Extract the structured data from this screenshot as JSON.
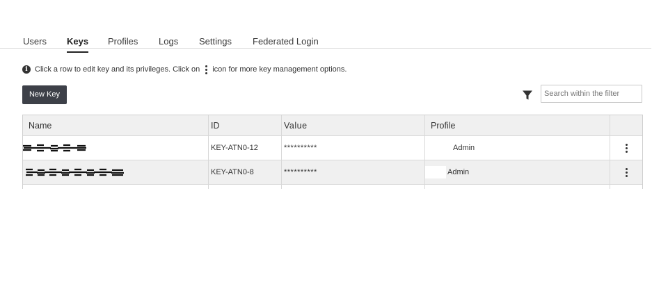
{
  "tabs": [
    {
      "label": "Users",
      "active": false
    },
    {
      "label": "Keys",
      "active": true
    },
    {
      "label": "Profiles",
      "active": false
    },
    {
      "label": "Logs",
      "active": false
    },
    {
      "label": "Settings",
      "active": false
    },
    {
      "label": "Federated Login",
      "active": false
    }
  ],
  "info": {
    "icon": "info-circle-icon",
    "text_before": "Click a row to edit key and its privileges. Click on",
    "text_after": "icon for more key management options."
  },
  "toolbar": {
    "new_key_label": "New Key",
    "filter_icon": "filter-funnel-icon",
    "search_placeholder": "Search within the filter"
  },
  "table": {
    "columns": [
      "Name",
      "ID",
      "Value",
      "Profile"
    ],
    "rows": [
      {
        "id": "KEY-ATN0-12",
        "value": "**********",
        "profile": "Admin"
      },
      {
        "id": "KEY-ATN0-8",
        "value": "**********",
        "profile": "Admin"
      }
    ]
  },
  "colors": {
    "button_bg": "#3d4048",
    "header_bg": "#f0f0f0",
    "border": "#d8d8d8"
  }
}
